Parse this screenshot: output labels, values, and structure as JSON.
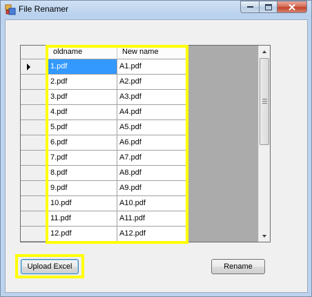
{
  "window": {
    "title": "File Renamer",
    "caption_buttons": {
      "minimize_icon": "minimize-icon",
      "maximize_icon": "maximize-icon",
      "close_icon": "close-icon"
    }
  },
  "grid": {
    "columns": [
      "oldname",
      "New name"
    ],
    "rows": [
      [
        "1.pdf",
        "A1.pdf"
      ],
      [
        "2.pdf",
        "A2.pdf"
      ],
      [
        "3.pdf",
        "A3.pdf"
      ],
      [
        "4.pdf",
        "A4.pdf"
      ],
      [
        "5.pdf",
        "A5.pdf"
      ],
      [
        "6.pdf",
        "A6.pdf"
      ],
      [
        "7.pdf",
        "A7.pdf"
      ],
      [
        "8.pdf",
        "A8.pdf"
      ],
      [
        "9.pdf",
        "A9.pdf"
      ],
      [
        "10.pdf",
        "A10.pdf"
      ],
      [
        "11.pdf",
        "A11.pdf"
      ],
      [
        "12.pdf",
        "A12.pdf"
      ]
    ],
    "selected_cell": "1.pdf",
    "current_row_indicator": "row-pointer-icon"
  },
  "buttons": {
    "upload_label": "Upload Excel",
    "rename_label": "Rename"
  },
  "colors": {
    "highlight": "#ffff00",
    "selection": "#3399ff"
  }
}
